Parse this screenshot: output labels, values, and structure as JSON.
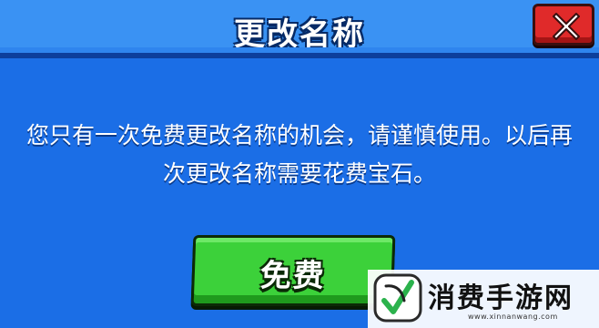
{
  "dialog": {
    "title": "更改名称",
    "message_line1": "您只有一次免费更改名称的机会，请谨慎使用。以后再",
    "message_line2": "次更改名称需要花费宝石。",
    "confirm_label": "免费"
  },
  "watermark": {
    "text": "消费手游网",
    "url": "www.xinnanwang.com"
  },
  "colors": {
    "background": "#1b6ee6",
    "title_bar": "#3a92f3",
    "close_button": "#e02a2a",
    "confirm_button": "#3cd13a"
  },
  "icons": {
    "close": "close-x-icon",
    "watermark_logo": "leaf-check-icon"
  }
}
